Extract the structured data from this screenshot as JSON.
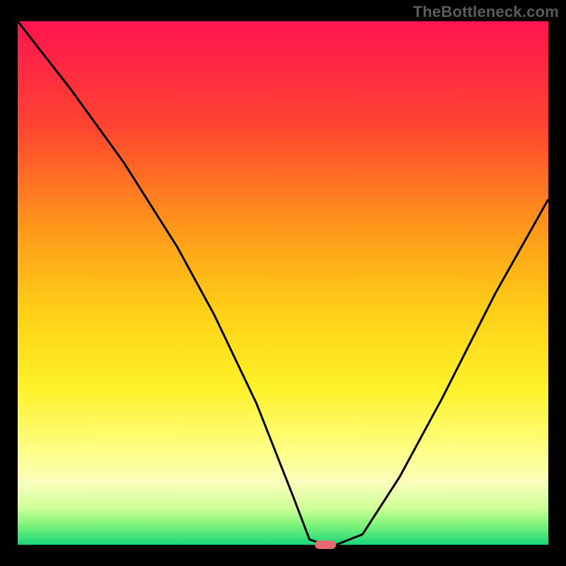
{
  "attribution": "TheBottleneck.com",
  "chart_data": {
    "type": "line",
    "title": "",
    "xlabel": "",
    "ylabel": "",
    "xlim": [
      0,
      100
    ],
    "ylim": [
      0,
      100
    ],
    "x": [
      0,
      10,
      20,
      30,
      37,
      45,
      52,
      55,
      58,
      60,
      65,
      72,
      80,
      90,
      100
    ],
    "values": [
      100,
      87,
      73,
      57,
      44,
      27,
      9,
      1,
      0,
      0,
      2,
      13,
      28,
      48,
      66
    ],
    "marker": {
      "x_start": 56,
      "x_end": 60,
      "y": 0
    },
    "gradient_stops": [
      {
        "pct": 0,
        "color": "#ff1450"
      },
      {
        "pct": 20,
        "color": "#ff4430"
      },
      {
        "pct": 40,
        "color": "#ff9a1a"
      },
      {
        "pct": 55,
        "color": "#ffce17"
      },
      {
        "pct": 70,
        "color": "#fff22a"
      },
      {
        "pct": 82,
        "color": "#ffff86"
      },
      {
        "pct": 88,
        "color": "#f9ffbc"
      },
      {
        "pct": 93,
        "color": "#d0ff9a"
      },
      {
        "pct": 96,
        "color": "#84f57a"
      },
      {
        "pct": 100,
        "color": "#18d77a"
      }
    ]
  }
}
